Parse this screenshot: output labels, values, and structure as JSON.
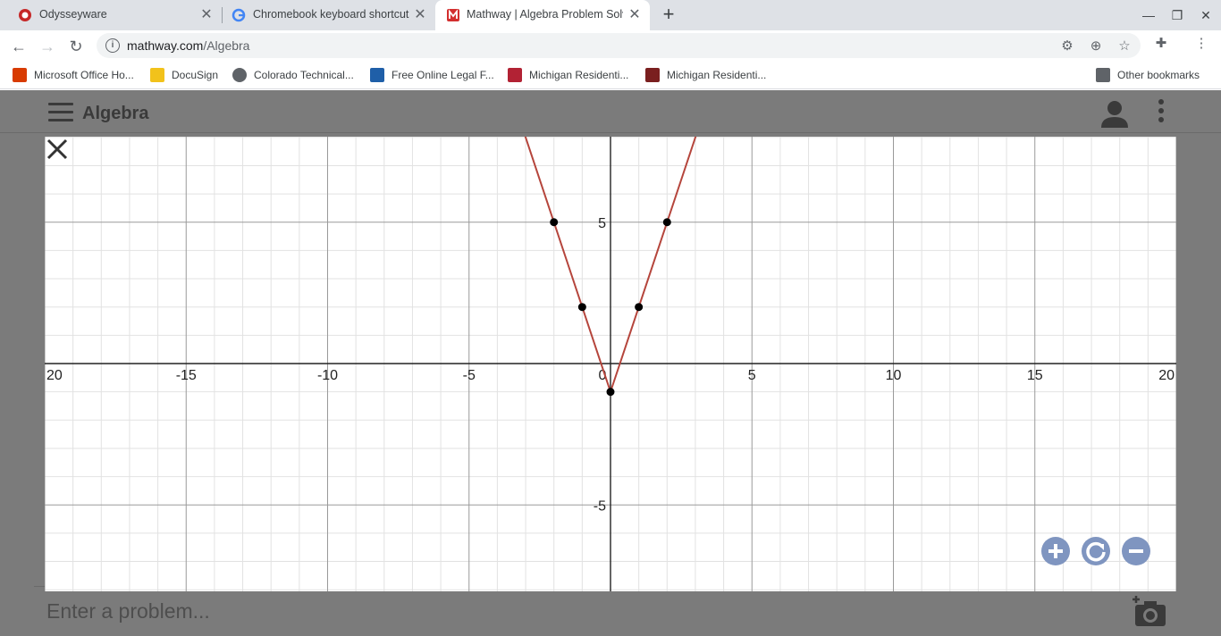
{
  "browser": {
    "tabs": [
      {
        "title": "Odysseyware",
        "active": false
      },
      {
        "title": "Chromebook keyboard shortcuts",
        "active": false
      },
      {
        "title": "Mathway | Algebra Problem Solver",
        "active": true
      }
    ],
    "new_tab_label": "+",
    "url_host": "mathway.com",
    "url_path": "/Algebra",
    "bookmarks": [
      {
        "label": "Microsoft Office Ho...",
        "color": "#d83b01"
      },
      {
        "label": "DocuSign",
        "color": "#f2c21b"
      },
      {
        "label": "Colorado Technical...",
        "color": "#5f6368"
      },
      {
        "label": "Free Online Legal F...",
        "color": "#1f5fa8"
      },
      {
        "label": "Michigan Residenti...",
        "color": "#b22234"
      },
      {
        "label": "Michigan Residenti...",
        "color": "#7a1f1f"
      }
    ],
    "other_bookmarks_label": "Other bookmarks"
  },
  "app": {
    "title": "Algebra",
    "problem_placeholder": "Enter a problem..."
  },
  "colors": {
    "curve": "#b5453c",
    "zoom_button": "#7f95c0",
    "overlay": "#7b7b7b"
  },
  "chart_data": {
    "type": "line",
    "title": "",
    "xlabel": "",
    "ylabel": "",
    "xlim": [
      -20,
      20
    ],
    "ylim": [
      -8,
      8
    ],
    "grid": true,
    "x_ticks": [
      -20,
      -15,
      -10,
      -5,
      0,
      5,
      10,
      15,
      20
    ],
    "x_tick_labels": [
      "20",
      "-15",
      "-10",
      "-5",
      "0",
      "5",
      "10",
      "15",
      "20"
    ],
    "y_ticks": [
      5,
      -5
    ],
    "y_tick_labels": [
      "5",
      "-5"
    ],
    "series": [
      {
        "x": [
          -4,
          0,
          4
        ],
        "y": [
          11,
          -1,
          11
        ]
      }
    ],
    "points": [
      {
        "x": -2,
        "y": 5
      },
      {
        "x": -1,
        "y": 2
      },
      {
        "x": 0,
        "y": -1
      },
      {
        "x": 1,
        "y": 2
      },
      {
        "x": 2,
        "y": 5
      }
    ]
  }
}
